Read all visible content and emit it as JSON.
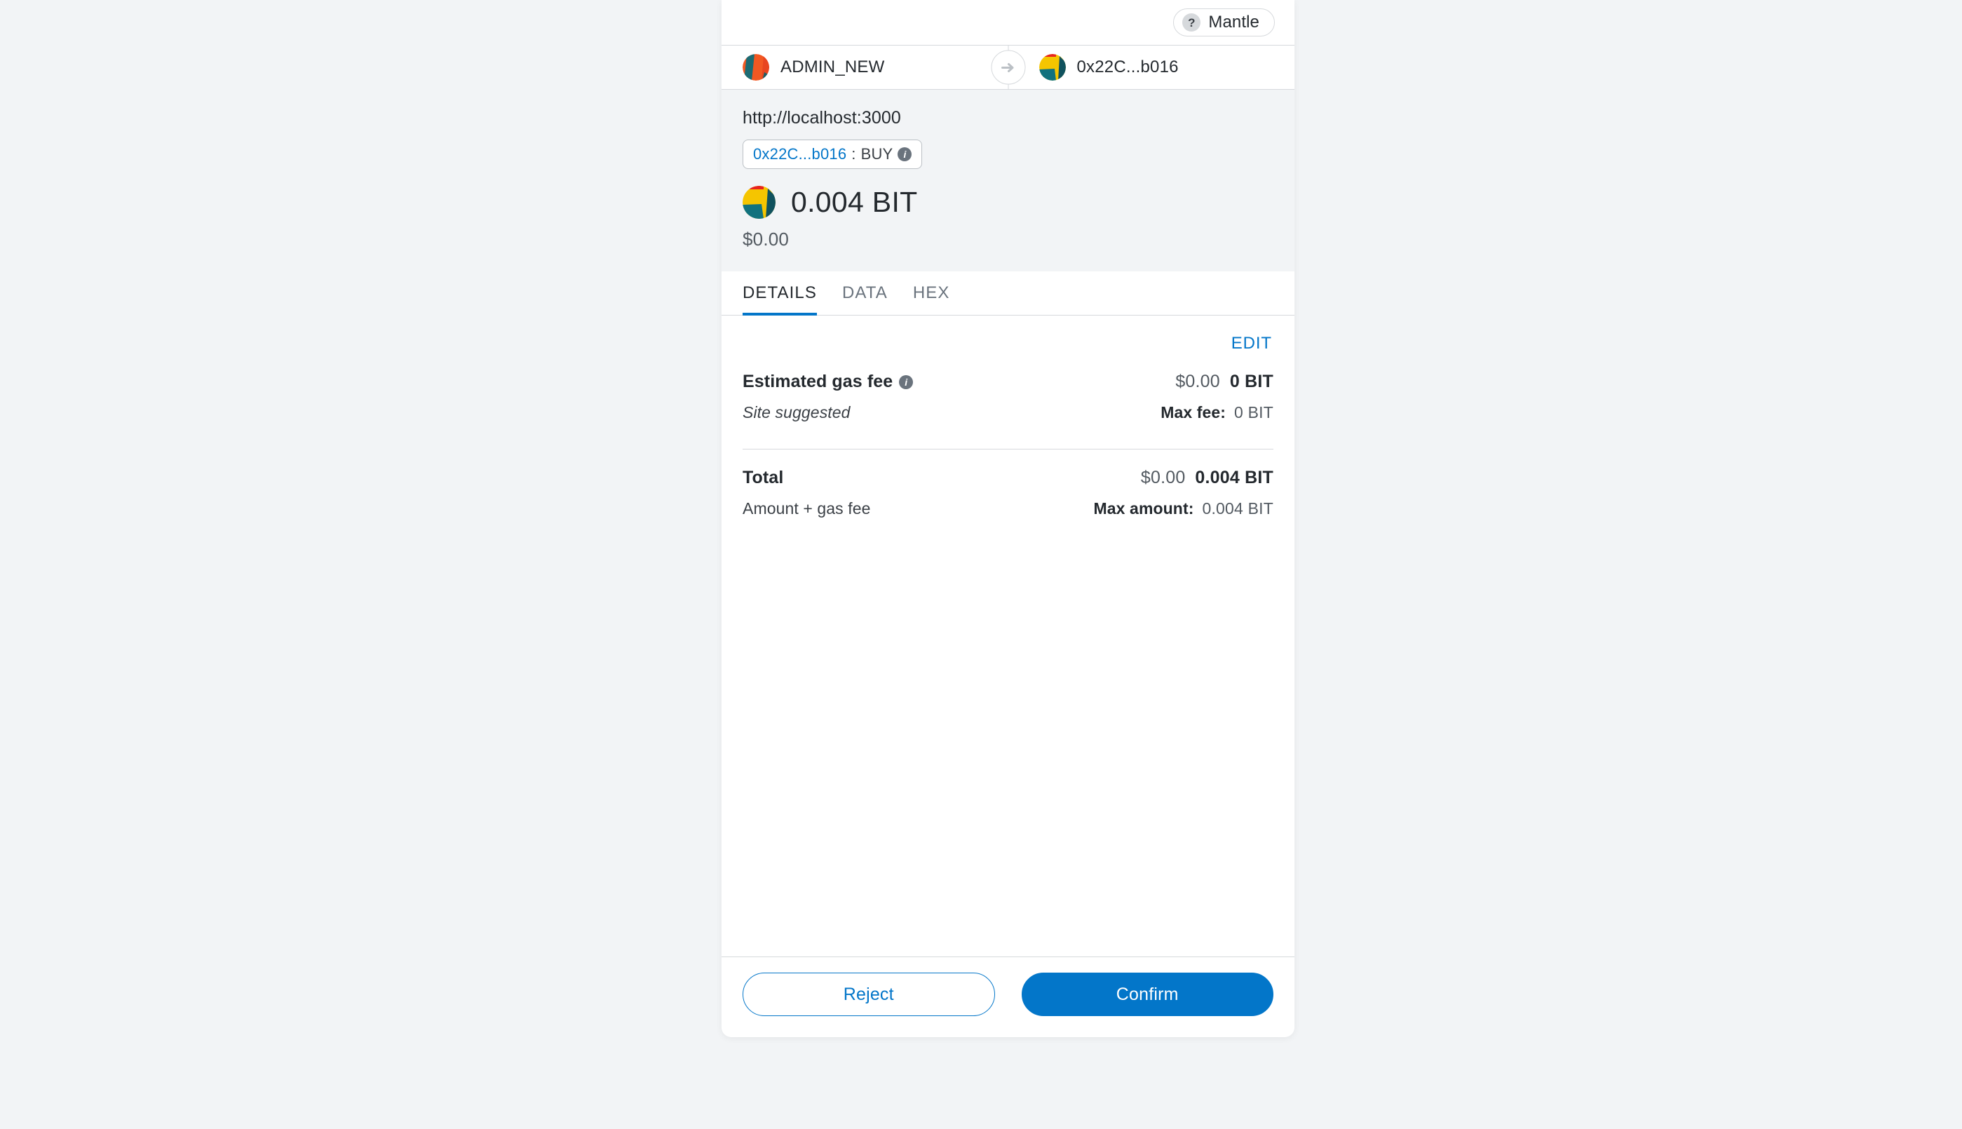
{
  "network": {
    "icon": "question-mark-icon",
    "name": "Mantle"
  },
  "accounts": {
    "from": {
      "name": "ADMIN_NEW",
      "avatar": "jazzicon-orange-teal"
    },
    "to": {
      "name": "0x22C...b016",
      "avatar": "jazzicon-yellow-teal"
    },
    "direction_icon": "arrow-right-icon"
  },
  "origin": {
    "url": "http://localhost:3000",
    "contract_address": "0x22C...b016",
    "separator": ":",
    "method": "BUY",
    "info_icon": "info-icon"
  },
  "amount": {
    "token_icon": "jazzicon-yellow-teal",
    "primary": "0.004 BIT",
    "fiat": "$0.00"
  },
  "tabs": [
    {
      "label": "DETAILS",
      "active": true
    },
    {
      "label": "DATA",
      "active": false
    },
    {
      "label": "HEX",
      "active": false
    }
  ],
  "details": {
    "edit_label": "EDIT",
    "gas": {
      "label": "Estimated gas fee",
      "info_icon": "info-icon",
      "fiat": "$0.00",
      "native": "0 BIT",
      "sub_left": "Site suggested",
      "sub_key": "Max fee:",
      "sub_value": "0 BIT"
    },
    "total": {
      "label": "Total",
      "fiat": "$0.00",
      "native": "0.004 BIT",
      "sub_left": "Amount + gas fee",
      "sub_key": "Max amount:",
      "sub_value": "0.004 BIT"
    }
  },
  "footer": {
    "reject_label": "Reject",
    "confirm_label": "Confirm"
  },
  "colors": {
    "accent": "#0376c9",
    "text": "#24292e",
    "muted": "#535a61",
    "border": "#d6d9dc",
    "panel_bg": "#f2f4f6"
  }
}
